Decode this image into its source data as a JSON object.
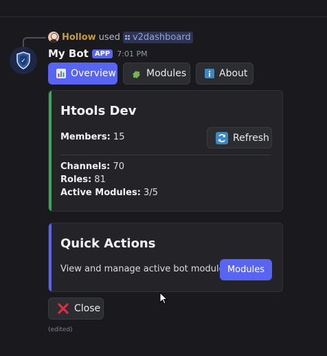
{
  "reply": {
    "user": "Hollow",
    "used": "used",
    "command": "v2dashboard"
  },
  "bot": {
    "name": "My Bot",
    "badge": "APP",
    "timestamp": "7:01 PM"
  },
  "tabs": [
    {
      "label": "Overview",
      "icon": "bar-chart-icon",
      "active": true
    },
    {
      "label": "Modules",
      "icon": "puzzle-icon",
      "active": false
    },
    {
      "label": "About",
      "icon": "info-icon",
      "active": false
    }
  ],
  "overview_card": {
    "accent": "#3ba55d",
    "title": "Htools Dev",
    "members_label": "Members:",
    "members_value": "15",
    "channels_label": "Channels:",
    "channels_value": "70",
    "roles_label": "Roles:",
    "roles_value": "81",
    "modules_label": "Active Modules:",
    "modules_value": "3/5",
    "refresh_label": "Refresh"
  },
  "quick_card": {
    "accent": "#5865f2",
    "title": "Quick Actions",
    "text": "View and manage active bot modules",
    "button_label": "Modules"
  },
  "close_label": "Close",
  "edited": "(edited)",
  "colors": {
    "blurple": "#5865f2",
    "green": "#3ba55d",
    "background": "#1a1a1e",
    "username": "#c69b3a",
    "command": "#8ea1e1"
  }
}
